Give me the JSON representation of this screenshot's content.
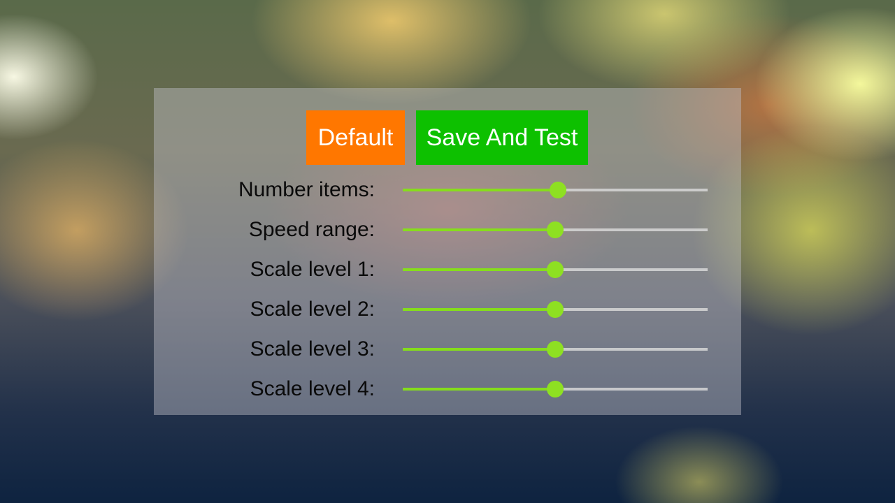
{
  "buttons": {
    "default_label": "Default",
    "save_label": "Save And Test"
  },
  "settings": [
    {
      "label": "Number items:",
      "value": 0.51
    },
    {
      "label": "Speed range:",
      "value": 0.5
    },
    {
      "label": "Scale level 1:",
      "value": 0.5
    },
    {
      "label": "Scale level 2:",
      "value": 0.5
    },
    {
      "label": "Scale level 3:",
      "value": 0.5
    },
    {
      "label": "Scale level 4:",
      "value": 0.5
    }
  ],
  "colors": {
    "default_button": "#ff7700",
    "save_button": "#0dc000",
    "slider_active": "#86dd1c",
    "slider_inactive": "#d7d7d7"
  }
}
